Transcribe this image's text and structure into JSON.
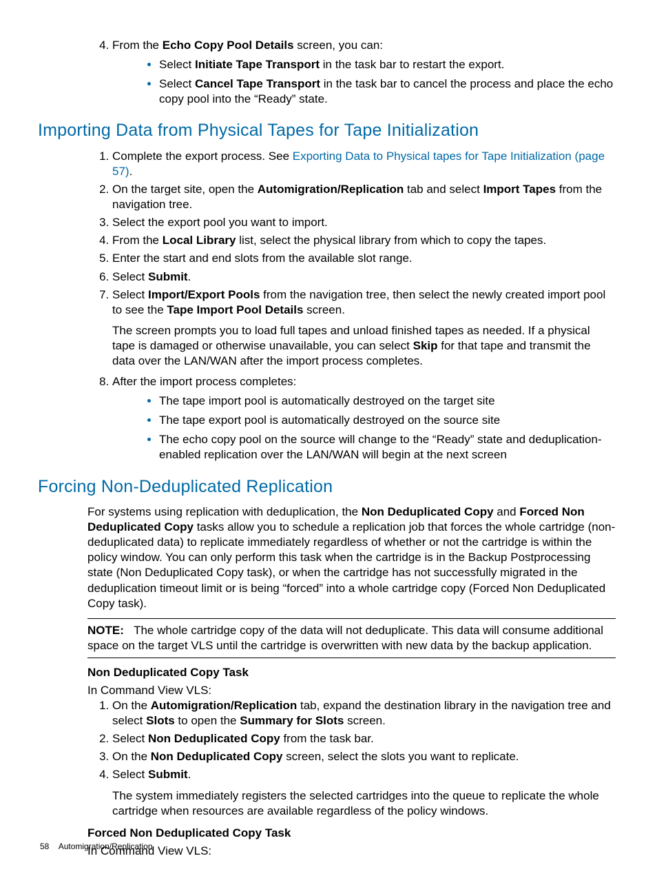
{
  "top_list": {
    "item4": {
      "prefix": "From the ",
      "bold": "Echo Copy Pool Details",
      "suffix": " screen, you can:"
    },
    "bullets": {
      "b1_pre": "Select ",
      "b1_bold": "Initiate Tape Transport",
      "b1_suf": " in the task bar to restart the export.",
      "b2_pre": "Select ",
      "b2_bold": "Cancel Tape Transport",
      "b2_suf": " in the task bar to cancel the process and place the echo copy pool into the “Ready” state."
    }
  },
  "section1": {
    "title": "Importing Data from Physical Tapes for Tape Initialization",
    "item1_pre": "Complete the export process. See ",
    "item1_link": "Exporting Data to Physical tapes for Tape Initialization (page 57)",
    "item1_suf": ".",
    "item2_pre": "On the target site, open the ",
    "item2_b1": "Automigration/Replication",
    "item2_mid": " tab and select ",
    "item2_b2": "Import Tapes",
    "item2_suf": " from the navigation tree.",
    "item3": "Select the export pool you want to import.",
    "item4_pre": "From the ",
    "item4_b": "Local Library",
    "item4_suf": " list, select the physical library from which to copy the tapes.",
    "item5": "Enter the start and end slots from the available slot range.",
    "item6_pre": "Select ",
    "item6_b": "Submit",
    "item6_suf": ".",
    "item7_pre": "Select ",
    "item7_b1": "Import/Export Pools",
    "item7_mid": " from the navigation tree, then select the newly created import pool to see the ",
    "item7_b2": "Tape Import Pool Details",
    "item7_suf": " screen.",
    "item7_para_pre": "The screen prompts you to load full tapes and unload finished tapes as needed. If a physical tape is damaged or otherwise unavailable, you can select ",
    "item7_para_b": "Skip",
    "item7_para_suf": " for that tape and transmit the data over the LAN/WAN after the import process completes.",
    "item8": "After the import process completes:",
    "item8_b1": "The tape import pool is automatically destroyed on the target site",
    "item8_b2": "The tape export pool is automatically destroyed on the source site",
    "item8_b3": "The echo copy pool on the source will change to the “Ready” state and deduplication-enabled replication over the LAN/WAN will begin at the next screen"
  },
  "section2": {
    "title": "Forcing Non-Deduplicated Replication",
    "para_pre": "For systems using replication with deduplication, the ",
    "para_b1": "Non Deduplicated Copy",
    "para_mid1": " and ",
    "para_b2": "Forced Non Deduplicated Copy",
    "para_suf": " tasks allow you to schedule a replication job that forces the whole cartridge (non-deduplicated data) to replicate immediately regardless of whether or not the cartridge is within the policy window. You can only perform this task when the cartridge is in the Backup Postprocessing state (Non Deduplicated Copy task), or when the cartridge has not successfully migrated in the deduplication timeout limit or is being “forced” into a whole cartridge copy (Forced Non Deduplicated Copy task).",
    "note_label": "NOTE:",
    "note_text": "The whole cartridge copy of the data will not deduplicate. This data will consume additional space on the target VLS until the cartridge is overwritten with new data by the backup application.",
    "sub1_title": "Non Deduplicated Copy Task",
    "sub_intro": "In Command View VLS:",
    "s1_i1_pre": "On the ",
    "s1_i1_b1": "Automigration/Replication",
    "s1_i1_mid": " tab, expand the destination library in the navigation tree and select ",
    "s1_i1_b2": "Slots",
    "s1_i1_mid2": " to open the ",
    "s1_i1_b3": "Summary for Slots",
    "s1_i1_suf": " screen.",
    "s1_i2_pre": "Select ",
    "s1_i2_b": "Non Deduplicated Copy",
    "s1_i2_suf": " from the task bar.",
    "s1_i3_pre": "On the ",
    "s1_i3_b": "Non Deduplicated Copy",
    "s1_i3_suf": " screen, select the slots you want to replicate.",
    "s1_i4_pre": "Select ",
    "s1_i4_b": "Submit",
    "s1_i4_suf": ".",
    "s1_i4_para": "The system immediately registers the selected cartridges into the queue to replicate the whole cartridge when resources are available regardless of the policy windows.",
    "sub2_title": "Forced Non Deduplicated Copy Task",
    "sub2_intro": "In Command View VLS:"
  },
  "footer": {
    "page": "58",
    "label": "Automigration/Replication"
  }
}
